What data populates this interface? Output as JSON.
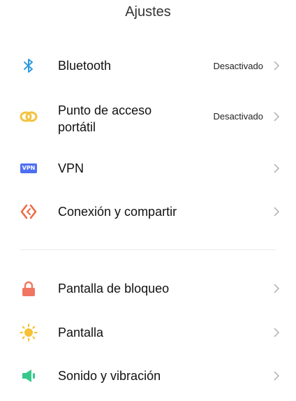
{
  "header": {
    "title": "Ajustes"
  },
  "section1": [
    {
      "label": "Bluetooth",
      "value": "Desactivado",
      "icon": "bluetooth-icon"
    },
    {
      "label": "Punto de acceso\nportátil",
      "value": "Desactivado",
      "icon": "hotspot-icon"
    },
    {
      "label": "VPN",
      "value": "",
      "icon": "vpn-icon",
      "icon_text": "VPN"
    },
    {
      "label": "Conexión y compartir",
      "value": "",
      "icon": "connection-sharing-icon"
    }
  ],
  "section2": [
    {
      "label": "Pantalla de bloqueo",
      "value": "",
      "icon": "lock-icon"
    },
    {
      "label": "Pantalla",
      "value": "",
      "icon": "sun-icon"
    },
    {
      "label": "Sonido y vibración",
      "value": "",
      "icon": "speaker-icon"
    }
  ],
  "colors": {
    "bluetooth": "#2f9be0",
    "hotspot": "#f2c341",
    "vpn": "#4e6ef2",
    "connection": "#f06a45",
    "lock": "#f07662",
    "sun": "#f7c136",
    "speaker": "#35c88a"
  }
}
